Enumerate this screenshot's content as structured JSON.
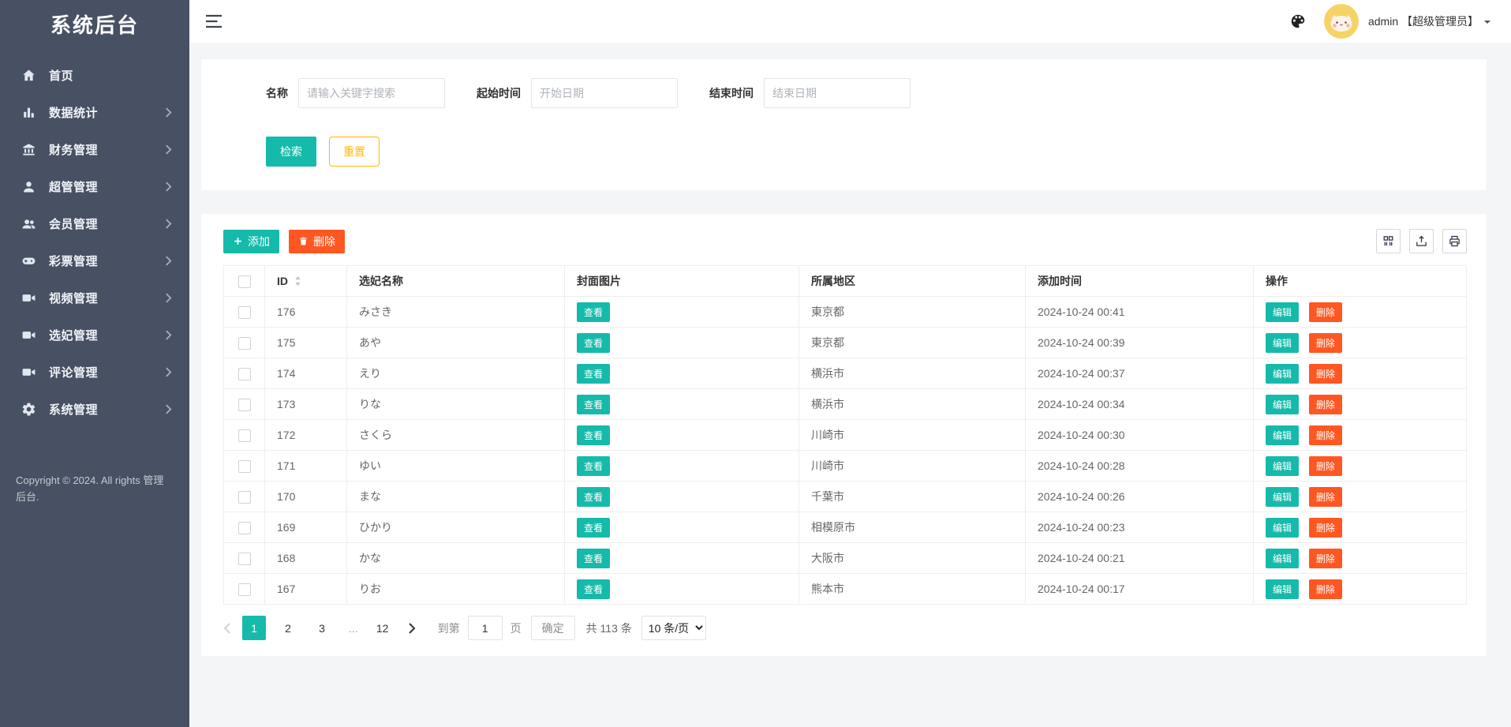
{
  "app": {
    "title": "系统后台"
  },
  "colors": {
    "sidebar": "#485163",
    "teal": "#16baaa",
    "orange": "#ff5722",
    "yellow": "#ffb800"
  },
  "sidebar": {
    "items": [
      {
        "label": "首页",
        "icon": "home-icon",
        "expandable": false
      },
      {
        "label": "数据统计",
        "icon": "chart-icon",
        "expandable": true
      },
      {
        "label": "财务管理",
        "icon": "bank-icon",
        "expandable": true
      },
      {
        "label": "超管管理",
        "icon": "user-icon",
        "expandable": true
      },
      {
        "label": "会员管理",
        "icon": "users-icon",
        "expandable": true
      },
      {
        "label": "彩票管理",
        "icon": "gamepad-icon",
        "expandable": true
      },
      {
        "label": "视频管理",
        "icon": "video-icon",
        "expandable": true
      },
      {
        "label": "选妃管理",
        "icon": "video-icon",
        "expandable": true
      },
      {
        "label": "评论管理",
        "icon": "video-icon",
        "expandable": true
      },
      {
        "label": "系统管理",
        "icon": "gear-icon",
        "expandable": true
      }
    ],
    "copyright": "Copyright © 2024. All rights 管理后台."
  },
  "header": {
    "user": "admin 【超级管理员】"
  },
  "search": {
    "name_label": "名称",
    "name_placeholder": "请输入关键字搜索",
    "start_label": "起始时间",
    "start_placeholder": "开始日期",
    "end_label": "结束时间",
    "end_placeholder": "结束日期",
    "search_button": "检索",
    "reset_button": "重置"
  },
  "toolbar": {
    "add_label": "添加",
    "delete_label": "删除"
  },
  "table": {
    "headers": {
      "id": "ID",
      "name": "选妃名称",
      "cover": "封面图片",
      "region": "所属地区",
      "time": "添加时间",
      "ops": "操作"
    },
    "view_label": "查看",
    "edit_label": "编辑",
    "row_delete_label": "删除",
    "rows": [
      {
        "id": "176",
        "name": "みさき",
        "region": "東京都",
        "time": "2024-10-24 00:41"
      },
      {
        "id": "175",
        "name": "あや",
        "region": "東京都",
        "time": "2024-10-24 00:39"
      },
      {
        "id": "174",
        "name": "えり",
        "region": "横浜市",
        "time": "2024-10-24 00:37"
      },
      {
        "id": "173",
        "name": "りな",
        "region": "横浜市",
        "time": "2024-10-24 00:34"
      },
      {
        "id": "172",
        "name": "さくら",
        "region": "川崎市",
        "time": "2024-10-24 00:30"
      },
      {
        "id": "171",
        "name": "ゆい",
        "region": "川崎市",
        "time": "2024-10-24 00:28"
      },
      {
        "id": "170",
        "name": "まな",
        "region": "千葉市",
        "time": "2024-10-24 00:26"
      },
      {
        "id": "169",
        "name": "ひかり",
        "region": "相模原市",
        "time": "2024-10-24 00:23"
      },
      {
        "id": "168",
        "name": "かな",
        "region": "大阪市",
        "time": "2024-10-24 00:21"
      },
      {
        "id": "167",
        "name": "りお",
        "region": "熊本市",
        "time": "2024-10-24 00:17"
      }
    ]
  },
  "pagination": {
    "pages": [
      "1",
      "2",
      "3",
      "...",
      "12"
    ],
    "active_page": "1",
    "goto_prefix": "到第",
    "goto_value": "1",
    "goto_suffix": "页",
    "confirm_label": "确定",
    "total_label": "共 113 条",
    "page_size": "10 条/页"
  }
}
